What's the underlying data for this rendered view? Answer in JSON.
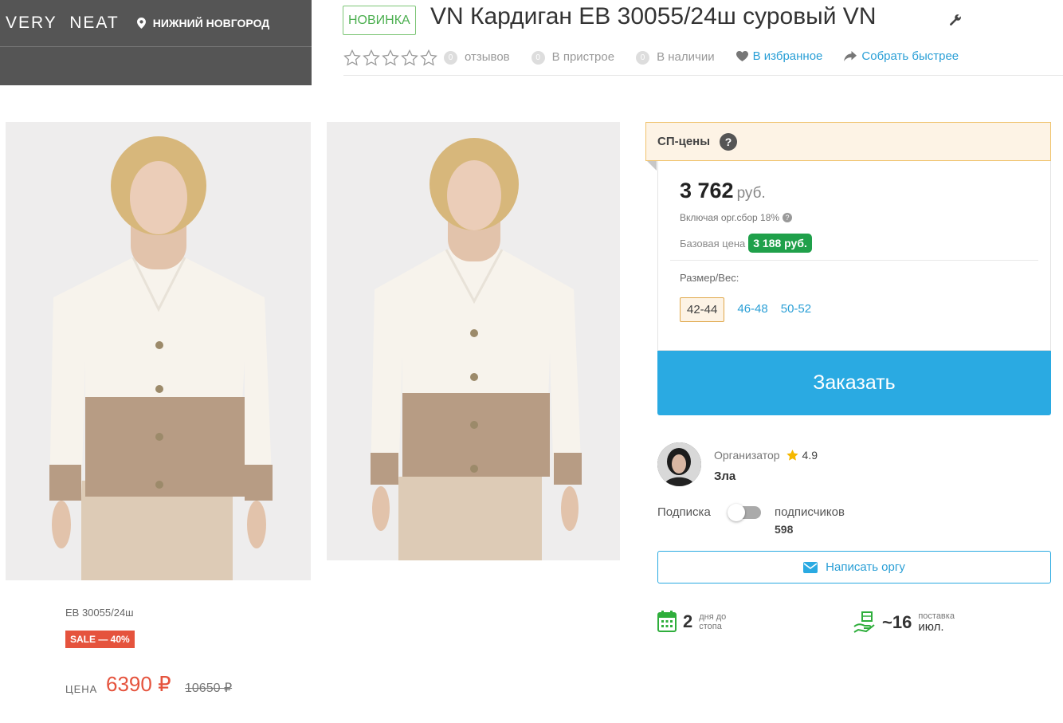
{
  "header": {
    "brand": "VERY NEAT",
    "city": "НИЖНИЙ НОВГОРОД"
  },
  "product": {
    "badge": "НОВИНКА",
    "title": "VN Кардиган EB 30055/24ш суровый VN",
    "rating_stars": 0,
    "meta": {
      "reviews_count": "0",
      "reviews_label": "отзывов",
      "pristroy_count": "0",
      "pristroy_label": "В пристрое",
      "stock_count": "0",
      "stock_label": "В наличии",
      "favorite_label": "В избранное",
      "share_label": "Собрать быстрее"
    },
    "sku": "EB 30055/24ш",
    "sale_badge": "SALE — 40%",
    "price_label": "ЦЕНА",
    "price_new": "6390 ₽",
    "price_old": "10650 ₽"
  },
  "pricing": {
    "header": "СП-цены",
    "help": "?",
    "amount": "3 762",
    "currency": "руб.",
    "included": "Включая орг.сбор 18%",
    "base_label": "Базовая цена",
    "base_value": "3 188 руб.",
    "sizes_label": "Размер/Вес:",
    "sizes": [
      "42-44",
      "46-48",
      "50-52"
    ],
    "selected_size": "42-44",
    "order_button": "Заказать"
  },
  "organizer": {
    "label": "Организатор",
    "rating": "4.9",
    "name": "Зла",
    "subscribe_label": "Подписка",
    "subscribers_label": "подписчиков",
    "subscribers_count": "598",
    "write_button": "Написать оргу"
  },
  "stats": {
    "days_value": "2",
    "days_label_1": "дня до",
    "days_label_2": "стопа",
    "delivery_value": "~16",
    "delivery_label": "поставка",
    "delivery_month": "июл."
  },
  "colors": {
    "accent": "#2aaae2",
    "sale": "#e5533d",
    "base_price": "#1fa04a",
    "brand_bar": "#555555"
  }
}
